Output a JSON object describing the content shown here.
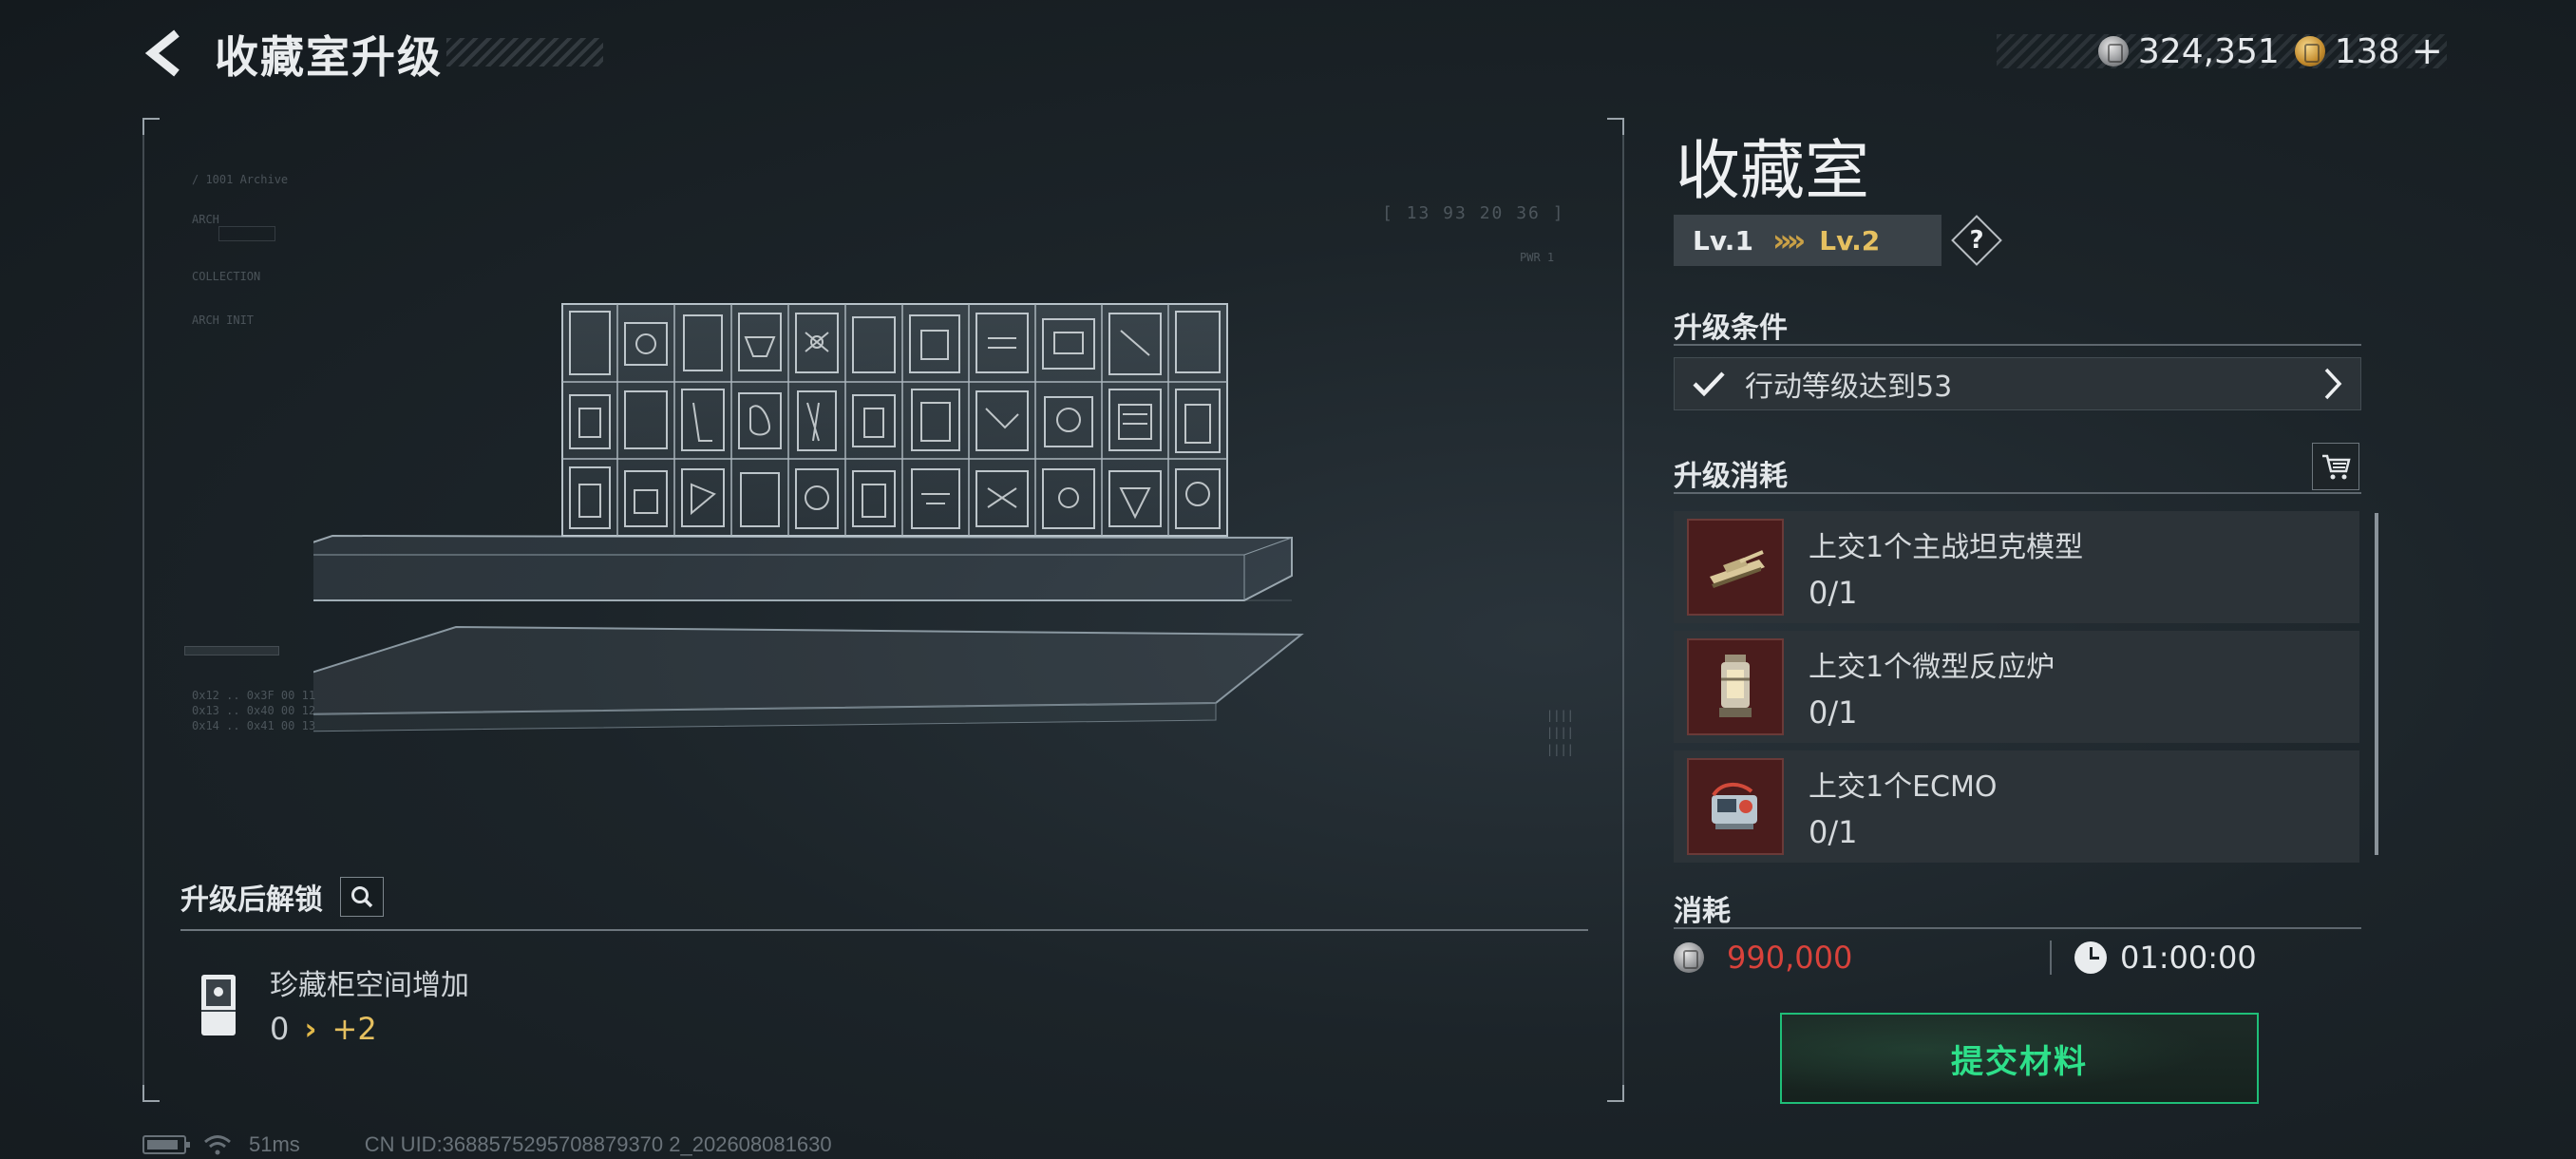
{
  "header": {
    "title": "收藏室升级",
    "currencies": [
      {
        "icon": "silver-coin-icon",
        "value": "324,351"
      },
      {
        "icon": "gold-coin-icon",
        "value": "138"
      }
    ],
    "add_label": "+"
  },
  "hologram": {
    "timecode": "[ 13 93   20 36 ]"
  },
  "unlock": {
    "title": "升级后解锁",
    "item_name": "珍藏柜空间增加",
    "from": "0",
    "arrow": "›",
    "to": "+2"
  },
  "status": {
    "ping": "51ms",
    "uid": "CN UID:3688575295708879370 2_202608081630"
  },
  "panel": {
    "room_name": "收藏室",
    "level_from": "Lv.1",
    "level_arrows": "»»",
    "level_to": "Lv.2",
    "help": "?",
    "conditions_title": "升级条件",
    "condition_text": "行动等级达到53",
    "consume_title": "升级消耗",
    "items": [
      {
        "name": "上交1个主战坦克模型",
        "count": "0/1",
        "icon": "tank-model-icon"
      },
      {
        "name": "上交1个微型反应炉",
        "count": "0/1",
        "icon": "micro-reactor-icon"
      },
      {
        "name": "上交1个ECMO",
        "count": "0/1",
        "icon": "ecmo-icon"
      }
    ],
    "cost_title": "消耗",
    "cost_value": "990,000",
    "time_value": "01:00:00",
    "submit_label": "提交材料"
  },
  "colors": {
    "accent_gold": "#e5c060",
    "cost_red": "#d9423b",
    "submit_green": "#2ee08a"
  }
}
